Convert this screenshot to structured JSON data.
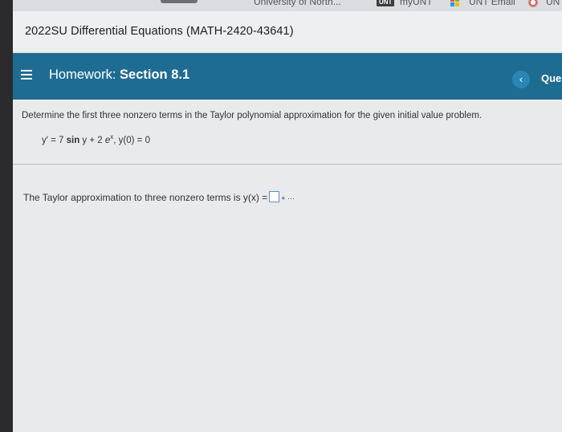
{
  "bookmarks": {
    "items": [
      {
        "label": "University of North..."
      },
      {
        "badge": "UNT",
        "label": "myUNT"
      },
      {
        "label": "UNT Email"
      },
      {
        "label": "UN"
      }
    ]
  },
  "course": {
    "title": "2022SU Differential Equations (MATH-2420-43641)"
  },
  "homework": {
    "prefix": "Homework:",
    "section": "Section 8.1",
    "prev_symbol": "‹",
    "question_label": "Que"
  },
  "question": {
    "prompt": "Determine the first three nonzero terms in the Taylor polynomial approximation for the given initial value problem.",
    "equation": {
      "lhs": "y′ = 7 ",
      "sin": "sin",
      "mid": " y + 2 ",
      "e": "e",
      "exp": "x",
      "ic": ", y(0) = 0"
    },
    "answer_prefix": "The Taylor approximation to three nonzero terms is y(x) =",
    "answer_value": "",
    "answer_suffix": "+ ···"
  },
  "colors": {
    "header_bar": "#1f6c92",
    "page_bg": "#e9eaec",
    "answer_border": "#5d8fc0"
  }
}
